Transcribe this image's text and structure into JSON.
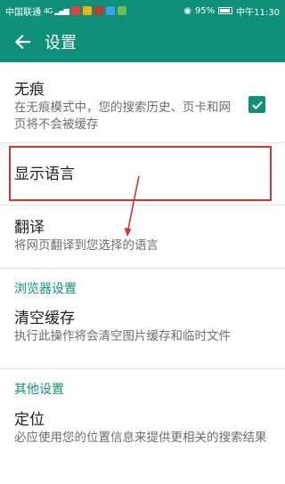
{
  "status_bar": {
    "carrier": "中国联通",
    "network": "4G",
    "battery": "95%",
    "time": "中午11:30"
  },
  "toolbar": {
    "title": "设置",
    "back_icon": "arrow-left-icon"
  },
  "settings": {
    "incognito": {
      "title": "无痕",
      "summary": "在无痕模式中，您的搜索历史、页卡和网页将不会被缓存",
      "checked": true
    },
    "language": {
      "title": "显示语言"
    },
    "translate": {
      "title": "翻译",
      "summary": "将网页翻译到您选择的语言"
    },
    "browser_section": "浏览器设置",
    "clear_cache": {
      "title": "清空缓存",
      "summary": "执行此操作将会清空图片缓存和临时文件"
    },
    "other_section": "其他设置",
    "location": {
      "title": "定位",
      "summary": "必应使用您的位置信息来提供更相关的搜索结果"
    }
  },
  "colors": {
    "accent": "#10907a",
    "annotation": "#d93030"
  }
}
